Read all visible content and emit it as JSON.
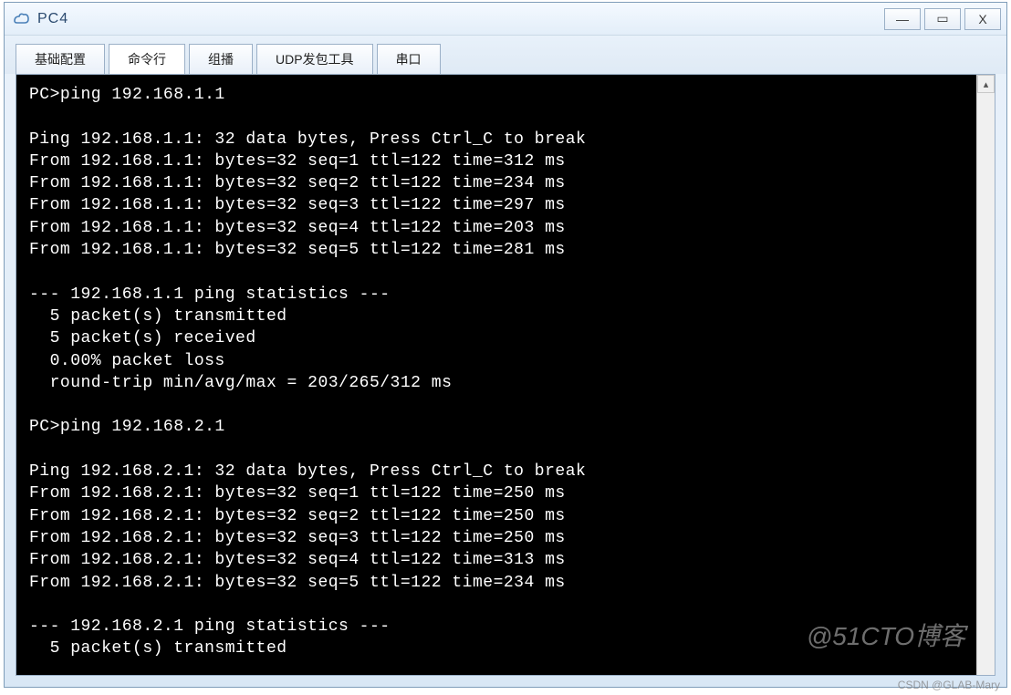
{
  "window": {
    "title": "PC4"
  },
  "tabs": [
    {
      "label": "基础配置",
      "active": false
    },
    {
      "label": "命令行",
      "active": true
    },
    {
      "label": "组播",
      "active": false
    },
    {
      "label": "UDP发包工具",
      "active": false
    },
    {
      "label": "串口",
      "active": false
    }
  ],
  "terminal_lines": [
    "PC>ping 192.168.1.1",
    "",
    "Ping 192.168.1.1: 32 data bytes, Press Ctrl_C to break",
    "From 192.168.1.1: bytes=32 seq=1 ttl=122 time=312 ms",
    "From 192.168.1.1: bytes=32 seq=2 ttl=122 time=234 ms",
    "From 192.168.1.1: bytes=32 seq=3 ttl=122 time=297 ms",
    "From 192.168.1.1: bytes=32 seq=4 ttl=122 time=203 ms",
    "From 192.168.1.1: bytes=32 seq=5 ttl=122 time=281 ms",
    "",
    "--- 192.168.1.1 ping statistics ---",
    "  5 packet(s) transmitted",
    "  5 packet(s) received",
    "  0.00% packet loss",
    "  round-trip min/avg/max = 203/265/312 ms",
    "",
    "PC>ping 192.168.2.1",
    "",
    "Ping 192.168.2.1: 32 data bytes, Press Ctrl_C to break",
    "From 192.168.2.1: bytes=32 seq=1 ttl=122 time=250 ms",
    "From 192.168.2.1: bytes=32 seq=2 ttl=122 time=250 ms",
    "From 192.168.2.1: bytes=32 seq=3 ttl=122 time=250 ms",
    "From 192.168.2.1: bytes=32 seq=4 ttl=122 time=313 ms",
    "From 192.168.2.1: bytes=32 seq=5 ttl=122 time=234 ms",
    "",
    "--- 192.168.2.1 ping statistics ---",
    "  5 packet(s) transmitted"
  ],
  "watermarks": {
    "w1": "@51CTO博客",
    "w2": "CSDN @GLAB-Mary"
  },
  "win_controls": {
    "min": "—",
    "max": "▭",
    "close": "X"
  }
}
